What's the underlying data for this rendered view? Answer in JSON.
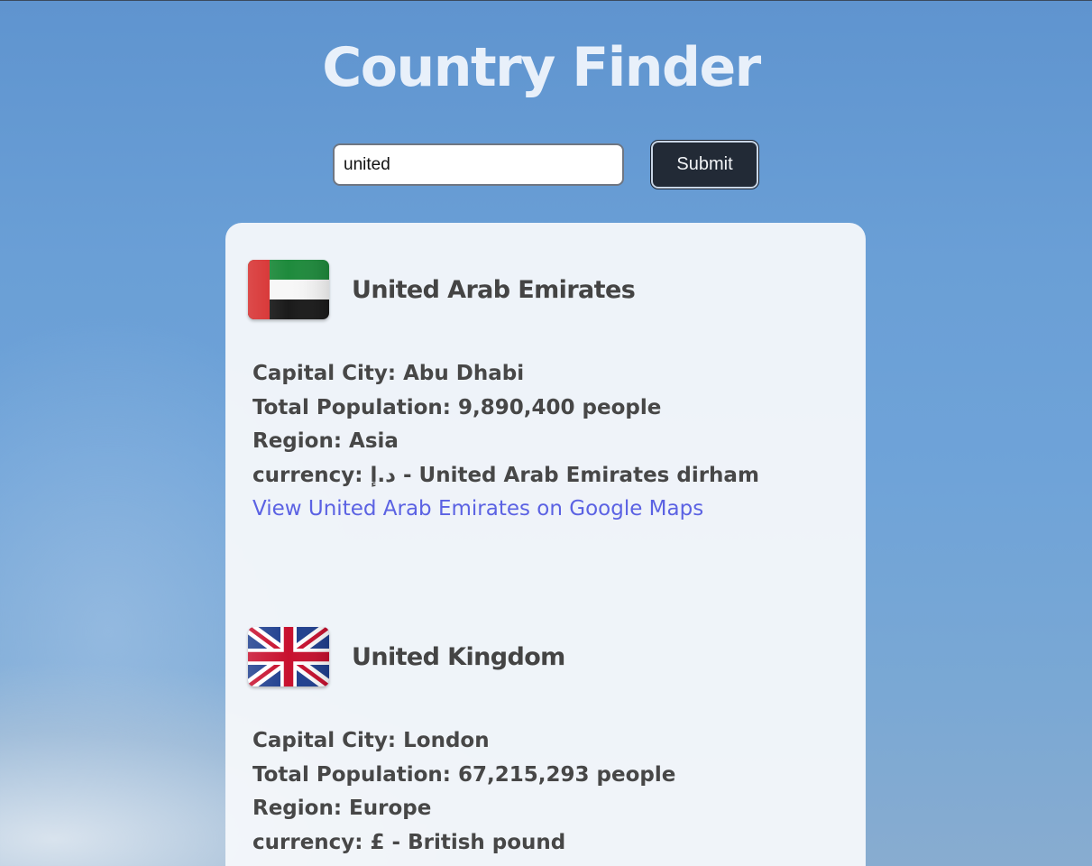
{
  "app": {
    "title": "Country Finder"
  },
  "search": {
    "value": "united",
    "placeholder": "",
    "submit_label": "Submit"
  },
  "results": [
    {
      "name": "United Arab Emirates",
      "flag_icon": "uae-flag-icon",
      "capital_label": "Capital City:",
      "capital": "Abu Dhabi",
      "population_label": "Total Population:",
      "population": "9,890,400 people",
      "region_label": "Region:",
      "region": "Asia",
      "currency_label": "currency:",
      "currency": "د.إ - United Arab Emirates dirham",
      "maps_link": "View United Arab Emirates on Google Maps"
    },
    {
      "name": "United Kingdom",
      "flag_icon": "uk-flag-icon",
      "capital_label": "Capital City:",
      "capital": "London",
      "population_label": "Total Population:",
      "population": "67,215,293 people",
      "region_label": "Region:",
      "region": "Europe",
      "currency_label": "currency:",
      "currency": "£ - British pound"
    }
  ],
  "colors": {
    "link": "#5b62e3",
    "button_bg": "#222a36",
    "card_bg": "#f6f8fb",
    "title": "#e8f0fa"
  }
}
